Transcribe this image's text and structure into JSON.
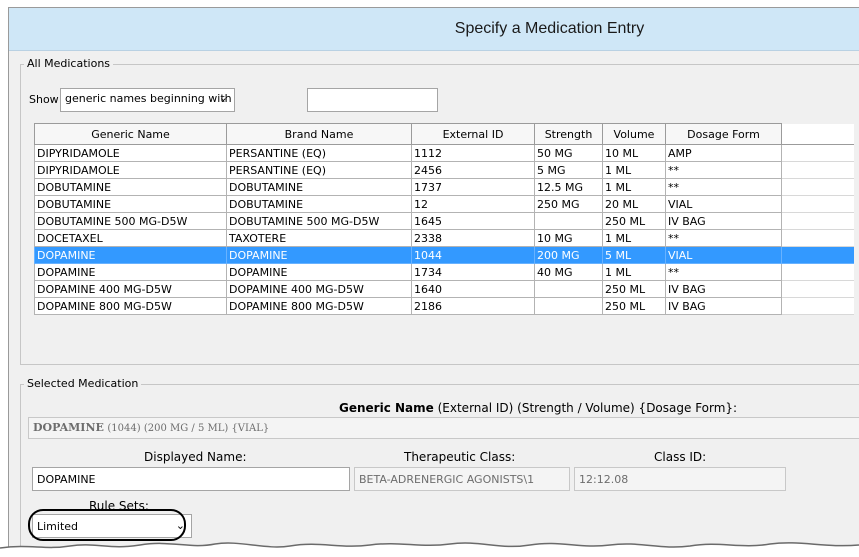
{
  "dialog": {
    "title": "Specify a Medication Entry"
  },
  "all_medications": {
    "legend": "All Medications",
    "show_label": "Show",
    "filter_mode": "generic names beginning with",
    "filter_text": "",
    "columns": [
      "Generic Name",
      "Brand Name",
      "External ID",
      "Strength",
      "Volume",
      "Dosage Form"
    ],
    "rows": [
      [
        "DIPYRIDAMOLE",
        "PERSANTINE (EQ)",
        "1112",
        "50 MG",
        "10 ML",
        "AMP"
      ],
      [
        "DIPYRIDAMOLE",
        "PERSANTINE (EQ)",
        "2456",
        "5 MG",
        "1 ML",
        "**"
      ],
      [
        "DOBUTAMINE",
        "DOBUTAMINE",
        "1737",
        "12.5 MG",
        "1 ML",
        "**"
      ],
      [
        "DOBUTAMINE",
        "DOBUTAMINE",
        "12",
        "250 MG",
        "20 ML",
        "VIAL"
      ],
      [
        "DOBUTAMINE 500 MG-D5W",
        "DOBUTAMINE 500 MG-D5W",
        "1645",
        "",
        "250 ML",
        "IV BAG"
      ],
      [
        "DOCETAXEL",
        "TAXOTERE",
        "2338",
        "10 MG",
        "1 ML",
        "**"
      ],
      [
        "DOPAMINE",
        "DOPAMINE",
        "1044",
        "200 MG",
        "5 ML",
        "VIAL"
      ],
      [
        "DOPAMINE",
        "DOPAMINE",
        "1734",
        "40 MG",
        "1 ML",
        "**"
      ],
      [
        "DOPAMINE 400 MG-D5W",
        "DOPAMINE 400 MG-D5W",
        "1640",
        "",
        "250 ML",
        "IV BAG"
      ],
      [
        "DOPAMINE 800 MG-D5W",
        "DOPAMINE 800 MG-D5W",
        "2186",
        "",
        "250 ML",
        "IV BAG"
      ]
    ],
    "selected_row": 6
  },
  "selected_medication": {
    "legend": "Selected Medication",
    "format_bold": "Generic Name",
    "format_rest": "(External ID)  (Strength / Volume)  {Dosage Form}:",
    "summary_bold": "DOPAMINE",
    "summary_rest": "(1044) (200 MG / 5 ML) {VIAL}",
    "displayed_name_label": "Displayed Name:",
    "displayed_name": "DOPAMINE",
    "therapeutic_class_label": "Therapeutic Class:",
    "therapeutic_class": "BETA-ADRENERGIC AGONISTS\\1",
    "class_id_label": "Class ID:",
    "class_id": "12:12.08",
    "rule_sets_label": "Rule Sets:",
    "rule_set": "Limited"
  },
  "colors": {
    "title_bar": "#cfe7f7",
    "selection": "#3399ff",
    "dialog_bg": "#f0f0f0"
  },
  "icons": {
    "dropdown": "chevron-down-icon"
  }
}
